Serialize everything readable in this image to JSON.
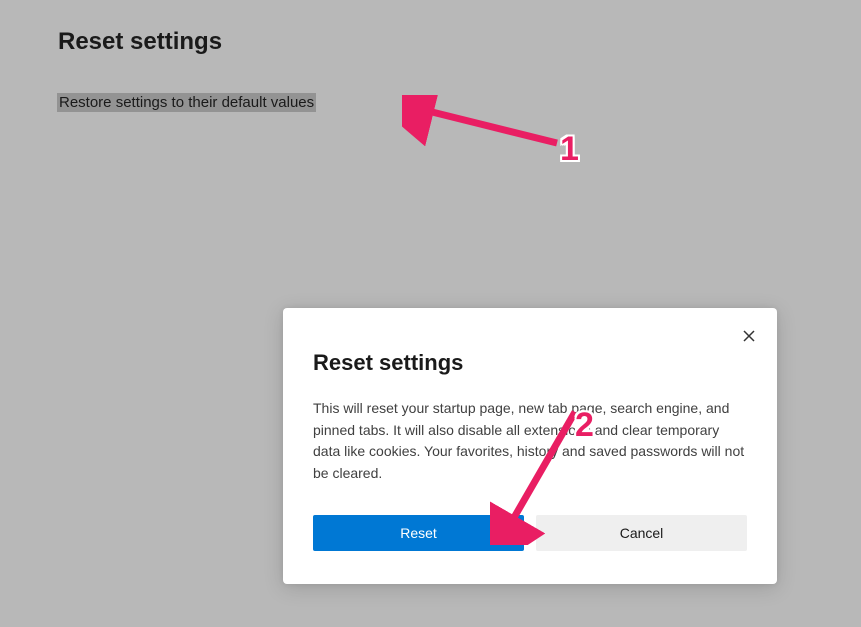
{
  "page": {
    "title": "Reset settings",
    "restore_link": "Restore settings to their default values"
  },
  "dialog": {
    "title": "Reset settings",
    "body": "This will reset your startup page, new tab page, search engine, and pinned tabs. It will also disable all extensions and clear temporary data like cookies. Your favorites, history and saved passwords will not be cleared.",
    "reset_label": "Reset",
    "cancel_label": "Cancel"
  },
  "annotations": {
    "label1": "1",
    "label2": "2",
    "color": "#e91e63"
  }
}
